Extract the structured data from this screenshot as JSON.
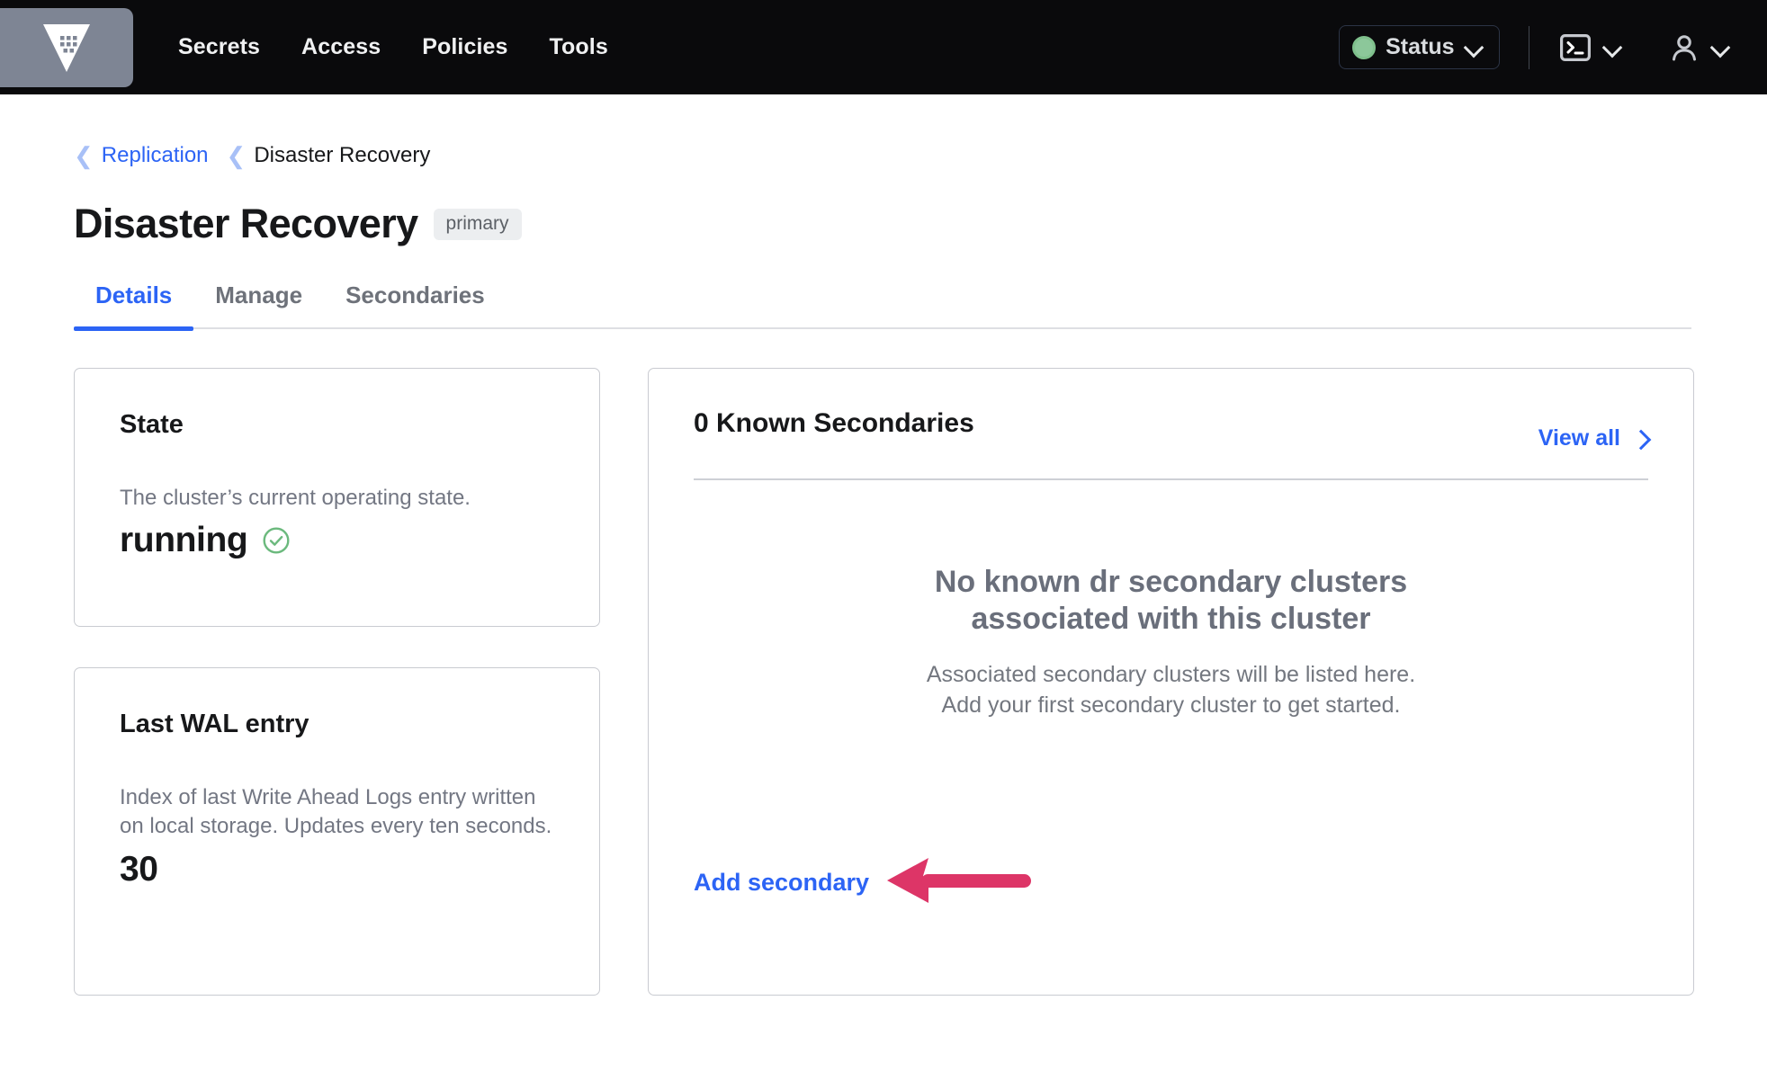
{
  "navbar": {
    "logo_icon": "vault-logo-icon",
    "links": [
      {
        "label": "Secrets"
      },
      {
        "label": "Access"
      },
      {
        "label": "Policies"
      },
      {
        "label": "Tools"
      }
    ],
    "status": {
      "label": "Status",
      "indicator_color": "#8cc79a",
      "chevron_icon": "chevron-down-icon"
    },
    "console": {
      "icon": "terminal-icon",
      "chevron_icon": "chevron-down-icon"
    },
    "user": {
      "icon": "user-icon",
      "chevron_icon": "chevron-down-icon"
    }
  },
  "breadcrumb": {
    "chevron_icon": "chevron-left-icon",
    "parent": "Replication",
    "current": "Disaster Recovery"
  },
  "header": {
    "title": "Disaster Recovery",
    "badge": "primary"
  },
  "tabs": [
    {
      "label": "Details",
      "active": true
    },
    {
      "label": "Manage",
      "active": false
    },
    {
      "label": "Secondaries",
      "active": false
    }
  ],
  "cards": [
    {
      "title": "State",
      "description": "The cluster’s current operating state.",
      "value": "running",
      "status_icon": "check-circle-icon",
      "status_color": "#6bb97d"
    },
    {
      "title": "Last WAL entry",
      "description": "Index of last Write Ahead Logs entry written on local storage. Updates every ten seconds.",
      "value": "30"
    }
  ],
  "secondaries_panel": {
    "title": "0 Known Secondaries",
    "view_all_label": "View all",
    "view_all_icon": "chevron-right-icon",
    "empty_title": "No known dr secondary clusters associated with this cluster",
    "empty_subtitle_line1": "Associated secondary clusters will be listed here.",
    "empty_subtitle_line2": "Add your first secondary cluster to get started.",
    "add_secondary_label": "Add secondary",
    "annotation": {
      "type": "arrow-left",
      "color": "#dd3567",
      "points_at": "add-secondary-link"
    }
  },
  "colors": {
    "nav_background": "#0a0a0c",
    "accent_blue": "#2c64f5",
    "logo_tile": "#7e8594",
    "card_border": "#c9cbd1",
    "annotation_pink": "#dd3567"
  }
}
